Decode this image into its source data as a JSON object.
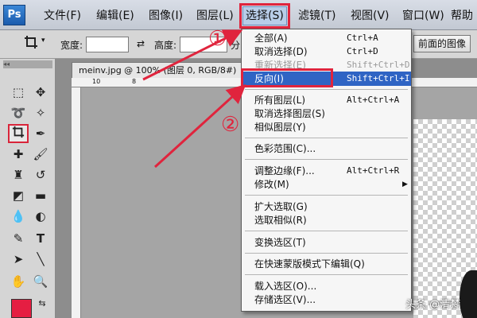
{
  "app": {
    "logo": "Ps"
  },
  "menubar": {
    "items": [
      "文件(F)",
      "编辑(E)",
      "图像(I)",
      "图层(L)",
      "选择(S)",
      "滤镜(T)",
      "视图(V)",
      "窗口(W)",
      "帮助"
    ]
  },
  "options": {
    "width_label": "宽度:",
    "height_label": "高度:",
    "swap_icon": "swap-arrows-icon",
    "resolution_fragment": "分",
    "front_image_button": "前面的图像"
  },
  "document": {
    "tab_title": "meinv.jpg @ 100% (图层 0, RGB/8#)",
    "ruler_ticks": [
      "10",
      "8"
    ]
  },
  "toolbox": {
    "collapse_glyph": "◂◂"
  },
  "select_menu": {
    "items": [
      {
        "label": "全部(A)",
        "shortcut": "Ctrl+A"
      },
      {
        "label": "取消选择(D)",
        "shortcut": "Ctrl+D"
      },
      {
        "label": "重新选择(E)",
        "shortcut": "Shift+Ctrl+D",
        "disabled": true
      },
      {
        "label": "反向(I)",
        "shortcut": "Shift+Ctrl+I",
        "highlighted": true
      },
      {
        "label": "所有图层(L)",
        "shortcut": "Alt+Ctrl+A"
      },
      {
        "label": "取消选择图层(S)",
        "shortcut": ""
      },
      {
        "label": "相似图层(Y)",
        "shortcut": ""
      },
      {
        "label": "色彩范围(C)...",
        "shortcut": ""
      },
      {
        "label": "调整边缘(F)...",
        "shortcut": "Alt+Ctrl+R"
      },
      {
        "label": "修改(M)",
        "shortcut": "",
        "submenu": true
      },
      {
        "label": "扩大选取(G)",
        "shortcut": ""
      },
      {
        "label": "选取相似(R)",
        "shortcut": ""
      },
      {
        "label": "变换选区(T)",
        "shortcut": ""
      },
      {
        "label": "在快速蒙版模式下编辑(Q)",
        "shortcut": ""
      },
      {
        "label": "载入选区(O)...",
        "shortcut": ""
      },
      {
        "label": "存储选区(V)...",
        "shortcut": ""
      }
    ]
  },
  "annotations": {
    "marker_1": "①",
    "marker_2": "②",
    "color": "#e0243d"
  },
  "watermark": "头条 @清梵",
  "colors": {
    "foreground_swatch": "#e51e42",
    "menu_highlight": "#2f64c4"
  }
}
